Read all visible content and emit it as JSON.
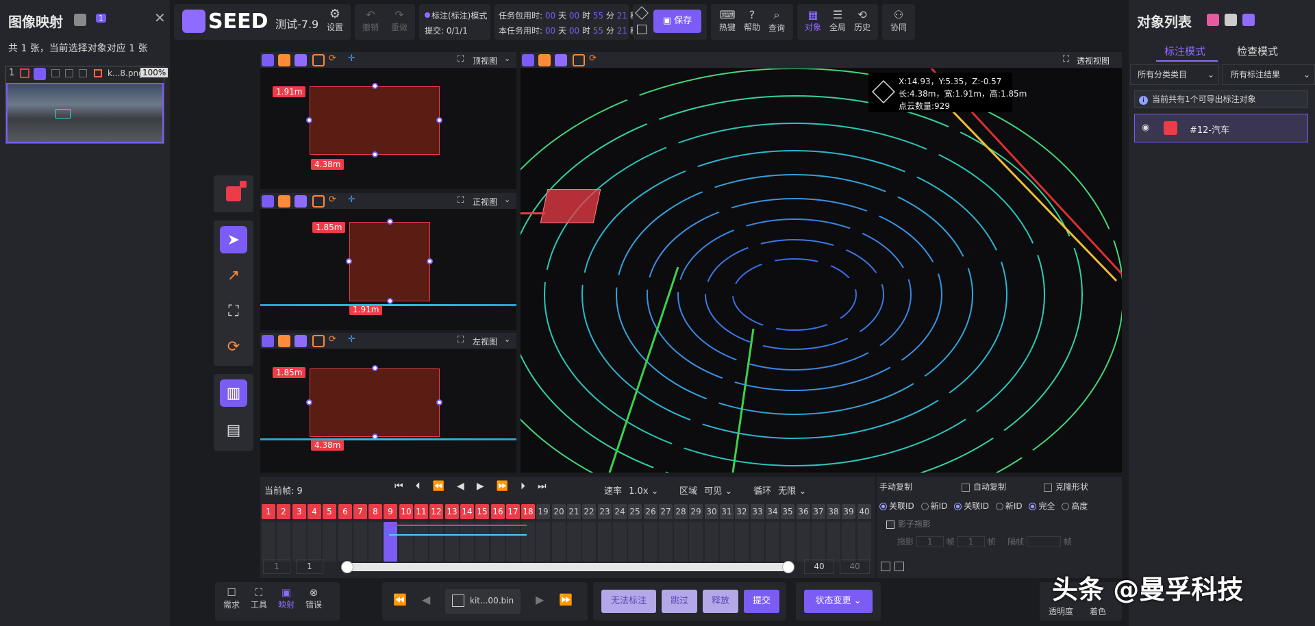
{
  "left_panel": {
    "title": "图像映射",
    "badge": "1",
    "summary": "共 1 张，当前选择对象对应 1 张",
    "thumb": {
      "index": "1",
      "filename": "k...8.png",
      "zoom": "100%"
    }
  },
  "toolbar": {
    "logo": "SEED",
    "task_name": "测试-7.9",
    "settings": "设置",
    "undo": "撤销",
    "redo": "重做",
    "mode": "标注(标注)模式",
    "submit": "提交: 0/1/1",
    "task_time_label": "任务包用时:",
    "this_task_label": "本任务用时:",
    "time": {
      "d": "00",
      "h": "00",
      "m": "55",
      "s": "21"
    },
    "time_units": {
      "d": "天",
      "h": "时",
      "m": "分",
      "s": "秒"
    },
    "save": "保存",
    "hotkeys": "热键",
    "help": "帮助",
    "query": "查询",
    "objects": "对象",
    "global": "全局",
    "history": "历史",
    "collab": "协同"
  },
  "views": {
    "top": {
      "name": "顶视图",
      "w": "1.91m",
      "l": "4.38m"
    },
    "front": {
      "name": "正视图",
      "h": "1.85m",
      "w": "1.91m"
    },
    "left": {
      "name": "左视图",
      "h": "1.85m",
      "l": "4.38m"
    },
    "persp": {
      "name": "透视视图"
    }
  },
  "info": {
    "coords": "X:14.93，Y:5.35，Z:-0.57",
    "dims": "长:4.38m，宽:1.91m，高:1.85m",
    "points": "点云数量:929"
  },
  "right_panel": {
    "title": "对象列表",
    "tab_label": "标注模式",
    "tab_check": "检查模式",
    "filter_category": "所有分类类目",
    "filter_result": "所有标注结果",
    "notice": "当前共有1个可导出标注对象",
    "object": "#12-汽车"
  },
  "timeline": {
    "current_label": "当前帧:",
    "current": "9",
    "speed_label": "速率",
    "speed": "1.0x",
    "area_label": "区域",
    "area": "可见",
    "loop_label": "循环",
    "loop": "无限",
    "frames": [
      "1",
      "2",
      "3",
      "4",
      "5",
      "6",
      "7",
      "8",
      "9",
      "10",
      "11",
      "12",
      "13",
      "14",
      "15",
      "16",
      "17",
      "18",
      "19",
      "20",
      "21",
      "22",
      "23",
      "24",
      "25",
      "26",
      "27",
      "28",
      "29",
      "30",
      "31",
      "32",
      "33",
      "34",
      "35",
      "36",
      "37",
      "38",
      "39",
      "40"
    ],
    "red_frames": 18,
    "range_start_a": "1",
    "range_start_b": "1",
    "range_end_a": "40",
    "range_end_b": "40"
  },
  "copy_panel": {
    "manual": "手动复制",
    "auto": "自动复制",
    "clone": "克隆形状",
    "link_id": "关联ID",
    "new_id": "新ID",
    "full": "完全",
    "height": "高度",
    "shadow": "影子拖影",
    "drag": "拖影",
    "frame": "帧",
    "interval": "隔帧",
    "drag_val": "1",
    "drag_val2": "1"
  },
  "bottom": {
    "demand": "需求",
    "tools": "工具",
    "mapping": "映射",
    "error": "错误",
    "file": "kit...00.bin",
    "no_label": "无法标注",
    "skip": "跳过",
    "release": "释放",
    "submit": "提交",
    "status_change": "状态变更",
    "opacity": "透明度",
    "color": "着色"
  },
  "watermark": "头条 @曼孚科技"
}
